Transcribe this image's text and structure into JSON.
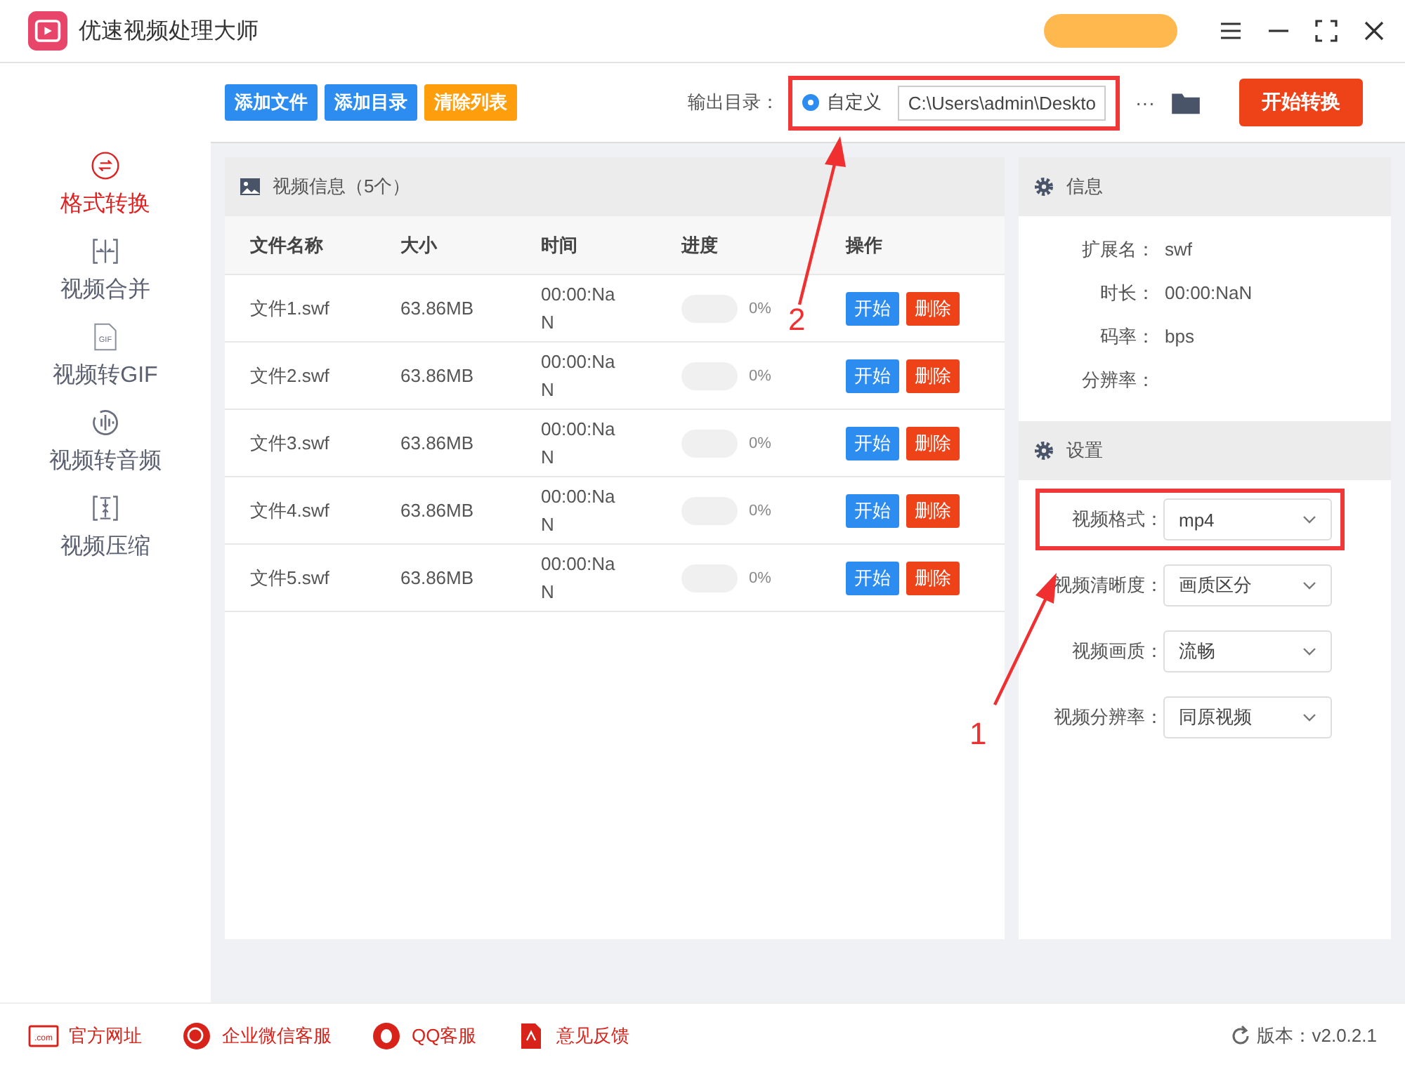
{
  "app": {
    "title": "优速视频处理大师"
  },
  "toolbar": {
    "buttons": [
      {
        "label": "添加文件",
        "kind": "primary"
      },
      {
        "label": "添加目录",
        "kind": "primary"
      },
      {
        "label": "清除列表",
        "kind": "warning"
      }
    ],
    "output_label": "输出目录：",
    "radio": {
      "label": "自定义",
      "selected": true
    },
    "path": "C:\\Users\\admin\\Deskto",
    "more": "···",
    "start": "开始转换",
    "highlighted": true
  },
  "sidebar": {
    "items": [
      {
        "label": "格式转换",
        "kind": "convert",
        "selected": true
      },
      {
        "label": "视频合并",
        "kind": "merge",
        "selected": false
      },
      {
        "label": "视频转GIF",
        "kind": "gif",
        "icon_text": "GIF",
        "selected": false
      },
      {
        "label": "视频转音频",
        "kind": "audio",
        "selected": false
      },
      {
        "label": "视频压缩",
        "kind": "compress",
        "selected": false
      }
    ]
  },
  "video_panel": {
    "title": "视频信息（5个）",
    "columns": [
      "文件名称",
      "大小",
      "时间",
      "进度",
      "操作"
    ],
    "rows": [
      {
        "name": "文件1.swf",
        "size": "63.86MB",
        "time": "00:00:NaN",
        "level": 0,
        "percent": "0%",
        "start": "开始",
        "delete": "删除"
      },
      {
        "name": "文件2.swf",
        "size": "63.86MB",
        "time": "00:00:NaN",
        "level": 0,
        "percent": "0%",
        "start": "开始",
        "delete": "删除"
      },
      {
        "name": "文件3.swf",
        "size": "63.86MB",
        "time": "00:00:NaN",
        "level": 0,
        "percent": "0%",
        "start": "开始",
        "delete": "删除"
      },
      {
        "name": "文件4.swf",
        "size": "63.86MB",
        "time": "00:00:NaN",
        "level": 0,
        "percent": "0%",
        "start": "开始",
        "delete": "删除"
      },
      {
        "name": "文件5.swf",
        "size": "63.86MB",
        "time": "00:00:NaN",
        "level": 0,
        "percent": "0%",
        "start": "开始",
        "delete": "删除"
      }
    ]
  },
  "info": {
    "title": "信息",
    "fields": [
      {
        "label": "扩展名：",
        "value": "swf"
      },
      {
        "label": "时长：",
        "value": "00:00:NaN"
      },
      {
        "label": "码率：",
        "value": "bps"
      },
      {
        "label": "分辨率："
      }
    ]
  },
  "settings": {
    "title": "设置",
    "fields": [
      {
        "label": "视频格式：",
        "value": "mp4",
        "highlighted": true
      },
      {
        "label": "视频清晰度：",
        "value": "画质区分",
        "highlighted": false
      },
      {
        "label": "视频画质：",
        "value": "流畅",
        "highlighted": false
      },
      {
        "label": "视频分辨率：",
        "value": "同原视频",
        "highlighted": false
      }
    ]
  },
  "annotations": [
    {
      "number": "1"
    },
    {
      "number": "2"
    }
  ],
  "footer": {
    "links": [
      {
        "label": "官方网址",
        "kind": "web",
        "icon_text": ".com"
      },
      {
        "label": "企业微信客服",
        "kind": "wechat"
      },
      {
        "label": "QQ客服",
        "kind": "qq"
      },
      {
        "label": "意见反馈",
        "kind": "feedback"
      }
    ],
    "version": "版本：v2.0.2.1"
  }
}
